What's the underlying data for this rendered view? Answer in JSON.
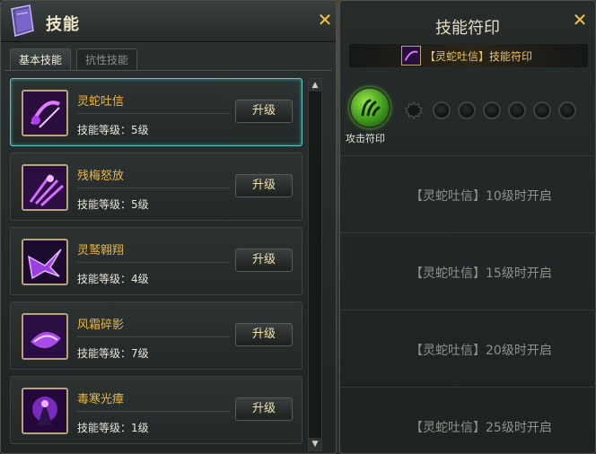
{
  "left_panel": {
    "title": "技能",
    "close": "✕",
    "tabs": [
      {
        "label": "基本技能"
      },
      {
        "label": "抗性技能"
      }
    ],
    "skills": [
      {
        "name": "灵蛇吐信",
        "level": "技能等级：5级",
        "button": "升级"
      },
      {
        "name": "残梅怒放",
        "level": "技能等级：5级",
        "button": "升级"
      },
      {
        "name": "灵鹫翱翔",
        "level": "技能等级：4级",
        "button": "升级"
      },
      {
        "name": "风霜碎影",
        "level": "技能等级：7级",
        "button": "升级"
      },
      {
        "name": "毒寒光瘴",
        "level": "技能等级：1级",
        "button": "升级"
      }
    ]
  },
  "right_panel": {
    "title": "技能符印",
    "close": "✕",
    "banner": "【灵蛇吐信】技能符印",
    "main_slot_label": "攻击符印",
    "locks": [
      "【灵蛇吐信】10级时开启",
      "【灵蛇吐信】15级时开启",
      "【灵蛇吐信】20级时开启",
      "【灵蛇吐信】25级时开启"
    ]
  },
  "colors": {
    "accent_gold": "#e8b64a",
    "selected_border": "#5fc4c4",
    "close_yellow": "#f5c43a",
    "rune_green": "#5fd02a"
  }
}
